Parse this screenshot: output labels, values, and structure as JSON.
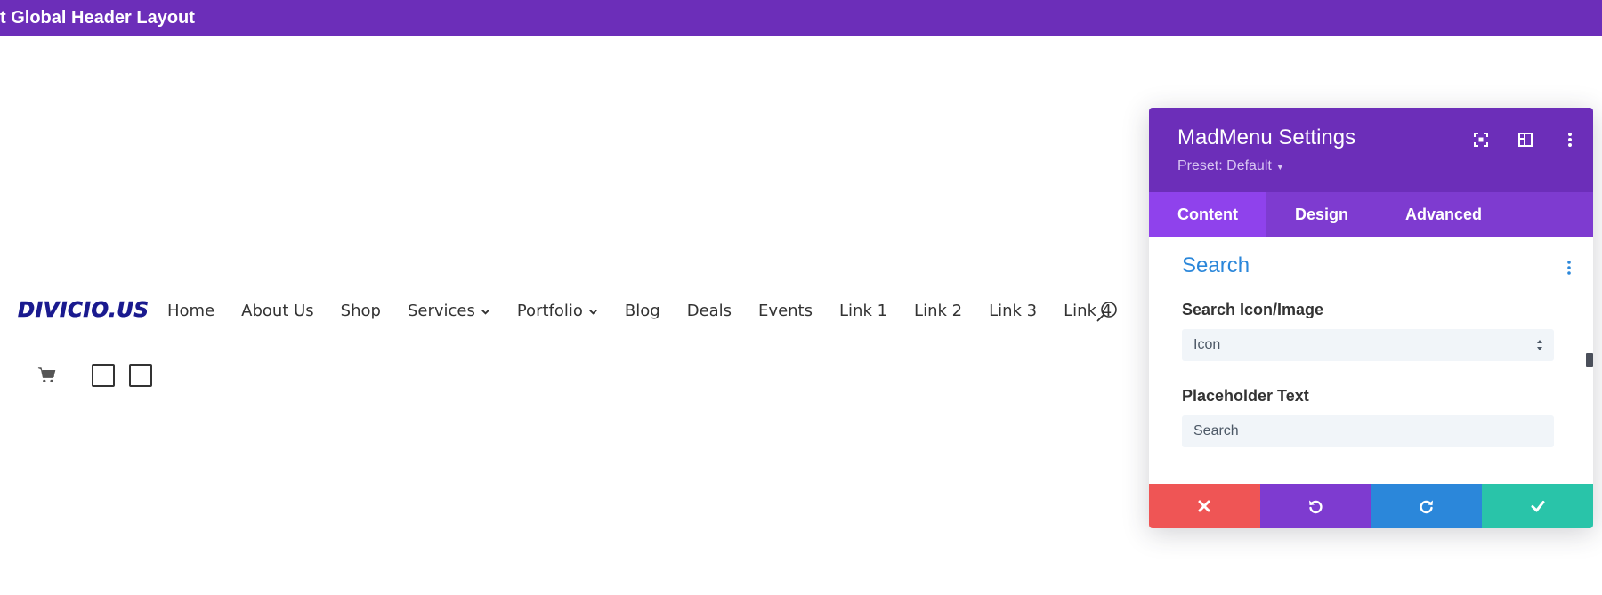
{
  "top_bar": {
    "title": "t Global Header Layout"
  },
  "header": {
    "logo_text": "DIVICIO.US",
    "nav_items": [
      {
        "label": "Home",
        "dropdown": false
      },
      {
        "label": "About Us",
        "dropdown": false
      },
      {
        "label": "Shop",
        "dropdown": false
      },
      {
        "label": "Services",
        "dropdown": true
      },
      {
        "label": "Portfolio",
        "dropdown": true
      },
      {
        "label": "Blog",
        "dropdown": false
      },
      {
        "label": "Deals",
        "dropdown": false
      },
      {
        "label": "Events",
        "dropdown": false
      },
      {
        "label": "Link 1",
        "dropdown": false
      },
      {
        "label": "Link 2",
        "dropdown": false
      },
      {
        "label": "Link 3",
        "dropdown": false
      },
      {
        "label": "Link 4",
        "dropdown": false
      }
    ],
    "search_icon": "search-icon",
    "cart_icon": "cart-icon"
  },
  "modal": {
    "title": "MadMenu Settings",
    "preset": "Preset: Default",
    "header_icons": [
      "fullscreen-icon",
      "sidebar-layout-icon",
      "more-vertical-icon"
    ],
    "tabs": [
      {
        "label": "Content",
        "active": true
      },
      {
        "label": "Design",
        "active": false
      },
      {
        "label": "Advanced",
        "active": false
      }
    ],
    "section": {
      "title": "Search",
      "fields": {
        "search_icon_label": "Search Icon/Image",
        "search_icon_value": "Icon",
        "placeholder_label": "Placeholder Text",
        "placeholder_value": "Search"
      }
    },
    "footer": {
      "buttons": [
        {
          "name": "discard",
          "icon": "close-icon",
          "color": "#ef5555"
        },
        {
          "name": "undo",
          "icon": "undo-icon",
          "color": "#7e3bd0"
        },
        {
          "name": "redo",
          "icon": "redo-icon",
          "color": "#2b87da"
        },
        {
          "name": "save",
          "icon": "check-icon",
          "color": "#29c4a9"
        }
      ]
    }
  },
  "colors": {
    "builder_purple": "#6c2eb9",
    "tab_bar": "#7e3bd0",
    "tab_active": "#8f42ec",
    "section_blue": "#2b87da",
    "logo_navy": "#1a1a8f"
  }
}
